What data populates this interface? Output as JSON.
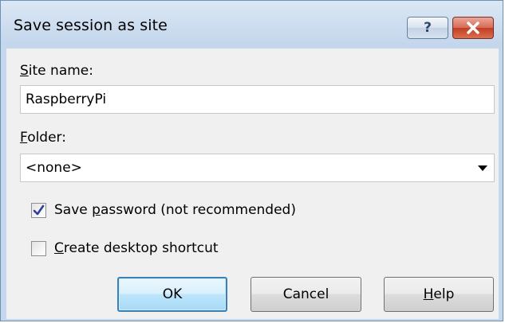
{
  "window": {
    "title": "Save session as site",
    "help_button_glyph": "?",
    "close_icon": "close-icon",
    "close_color": "#c23d24"
  },
  "site_name": {
    "label_prefix_u": "S",
    "label_rest": "ite name:",
    "value": "RaspberryPi"
  },
  "folder": {
    "label_prefix_u": "F",
    "label_rest": "older:",
    "selected": "<none>"
  },
  "save_password": {
    "label_before": "Save ",
    "label_u": "p",
    "label_after": "assword (not recommended)",
    "checked": true
  },
  "desktop_shortcut": {
    "label_u": "C",
    "label_after": "reate desktop shortcut",
    "checked": false
  },
  "buttons": {
    "ok": "OK",
    "cancel": "Cancel",
    "help_u": "H",
    "help_rest": "elp"
  },
  "colors": {
    "titlebar": "#c4d7ec",
    "client": "#f0f0f0",
    "default_button_border": "#3c7fb1"
  }
}
